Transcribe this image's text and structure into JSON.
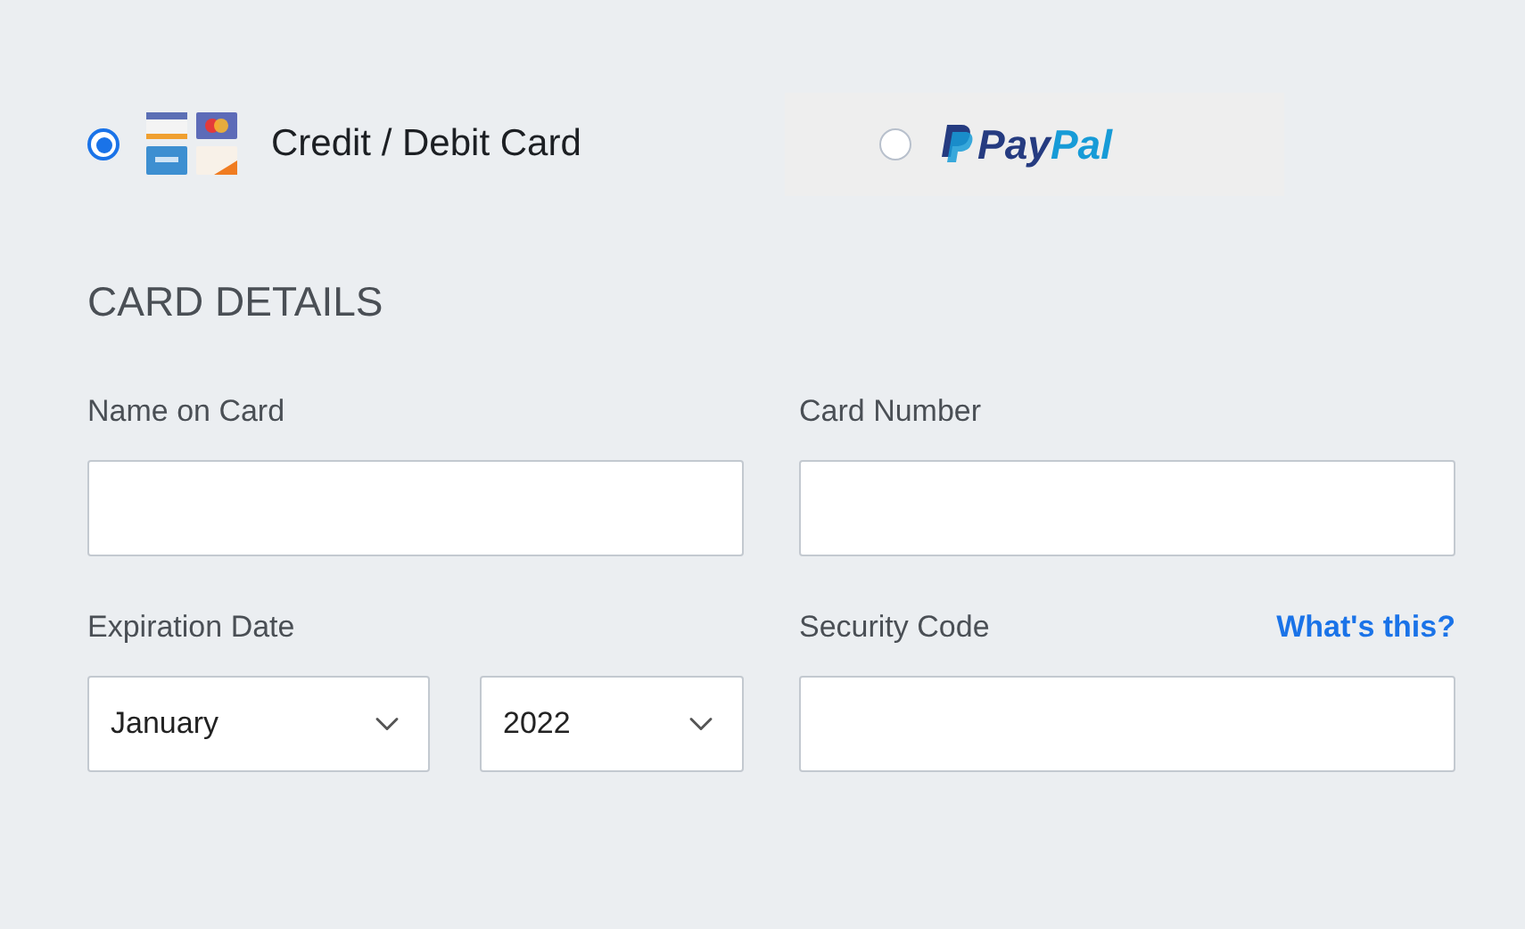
{
  "payment_methods": [
    {
      "kind": "card",
      "label": "Credit / Debit Card",
      "selected": true
    },
    {
      "kind": "paypal",
      "logo_parts": [
        "Pay",
        "Pal"
      ],
      "selected": false
    }
  ],
  "section_title": "CARD DETAILS",
  "fields": [
    {
      "kind": "text",
      "label": "Name on Card"
    },
    {
      "kind": "text",
      "label": "Card Number"
    },
    {
      "kind": "expiry",
      "label": "Expiration Date",
      "month": "January",
      "year": "2022"
    },
    {
      "kind": "text",
      "label": "Security Code",
      "link": "What's this?"
    }
  ]
}
